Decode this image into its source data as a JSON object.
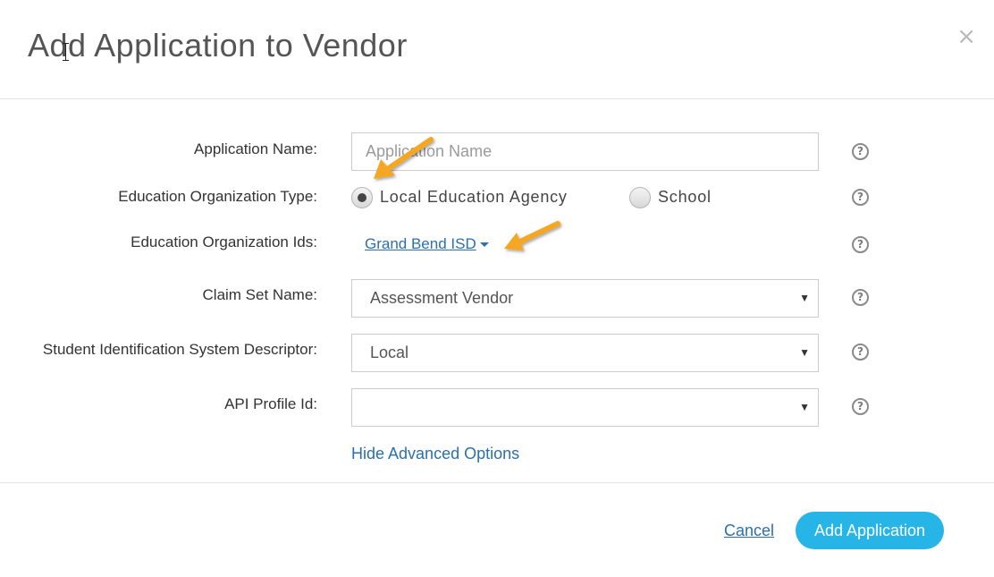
{
  "dialog": {
    "title": "Add Application to Vendor",
    "close_glyph": "×"
  },
  "form": {
    "application_name": {
      "label": "Application Name:",
      "value": "",
      "placeholder": "Application Name"
    },
    "education_org_type": {
      "label": "Education Organization Type:",
      "options": [
        {
          "label": "Local Education Agency",
          "checked": true
        },
        {
          "label": "School",
          "checked": false
        }
      ]
    },
    "education_org_ids": {
      "label": "Education Organization Ids:",
      "selected": "Grand Bend ISD"
    },
    "claim_set_name": {
      "label": "Claim Set Name:",
      "value": "Assessment Vendor"
    },
    "student_id_system_descriptor": {
      "label": "Student Identification System Descriptor:",
      "value": "Local"
    },
    "api_profile_id": {
      "label": "API Profile Id:",
      "value": ""
    },
    "toggle_advanced_label": "Hide Advanced Options",
    "help_glyph": "?",
    "caret_glyph": "▼"
  },
  "footer": {
    "cancel_label": "Cancel",
    "submit_label": "Add Application"
  },
  "colors": {
    "primary_button": "#27b5e8",
    "link": "#2a6fb0",
    "annotation_arrow": "#f5a623"
  },
  "icons": {
    "close": "close-icon",
    "help": "question-circle-icon",
    "annotation": "arrow-annotation-icon"
  }
}
